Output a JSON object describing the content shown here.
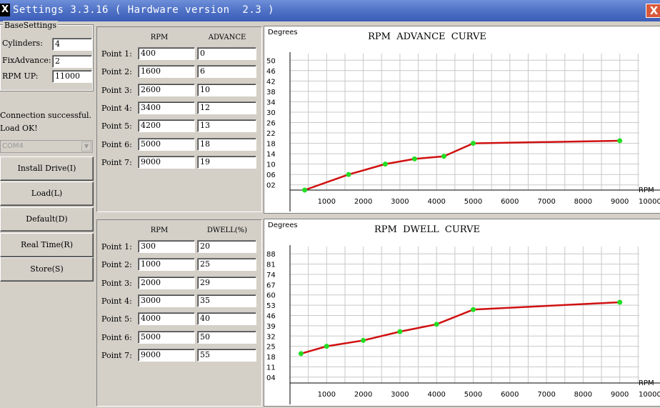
{
  "window": {
    "title": "Settings 3.3.16 ( Hardware version  2.3 )",
    "app_icon": "X",
    "close_label": "X"
  },
  "base_settings": {
    "group_label": "BaseSettings",
    "cylinders_label": "Cylinders:",
    "cylinders_value": "4",
    "fix_advance_label": "FixAdvance:",
    "fix_advance_value": "2",
    "rpm_up_label": "RPM UP:",
    "rpm_up_value": "11000"
  },
  "status": {
    "line1": "Connection successful.",
    "line2": "Load OK!"
  },
  "port": {
    "selected": "COM4"
  },
  "buttons": {
    "install_drive": "Install Drive(I)",
    "load": "Load(L)",
    "default": "Default(D)",
    "real_time": "Real Time(R)",
    "store": "Store(S)"
  },
  "advance_table": {
    "headers": [
      "RPM",
      "ADVANCE"
    ],
    "rows": [
      {
        "label": "Point 1:",
        "rpm": "400",
        "value": "0"
      },
      {
        "label": "Point 2:",
        "rpm": "1600",
        "value": "6"
      },
      {
        "label": "Point 3:",
        "rpm": "2600",
        "value": "10"
      },
      {
        "label": "Point 4:",
        "rpm": "3400",
        "value": "12"
      },
      {
        "label": "Point 5:",
        "rpm": "4200",
        "value": "13"
      },
      {
        "label": "Point 6:",
        "rpm": "5000",
        "value": "18"
      },
      {
        "label": "Point 7:",
        "rpm": "9000",
        "value": "19"
      }
    ]
  },
  "dwell_table": {
    "headers": [
      "RPM",
      "DWELL(%)"
    ],
    "rows": [
      {
        "label": "Point 1:",
        "rpm": "300",
        "value": "20"
      },
      {
        "label": "Point 2:",
        "rpm": "1000",
        "value": "25"
      },
      {
        "label": "Point 3:",
        "rpm": "2000",
        "value": "29"
      },
      {
        "label": "Point 4:",
        "rpm": "3000",
        "value": "35"
      },
      {
        "label": "Point 5:",
        "rpm": "4000",
        "value": "40"
      },
      {
        "label": "Point 6:",
        "rpm": "5000",
        "value": "50"
      },
      {
        "label": "Point 7:",
        "rpm": "9000",
        "value": "55"
      }
    ]
  },
  "colors": {
    "line": "#d01010",
    "point": "#22dd22",
    "grid": "#c8c8c8"
  },
  "chart_data": [
    {
      "type": "line",
      "title": "RPM  ADVANCE  CURVE",
      "ylabel": "Degrees",
      "xlabel": "RPM",
      "x_ticks": [
        "1000",
        "2000",
        "3000",
        "4000",
        "5000",
        "6000",
        "7000",
        "8000",
        "9000",
        "10000"
      ],
      "y_ticks": [
        "02",
        "06",
        "10",
        "14",
        "18",
        "22",
        "26",
        "30",
        "34",
        "38",
        "42",
        "46",
        "50"
      ],
      "xlim": [
        0,
        10000
      ],
      "ylim": [
        0,
        52
      ],
      "x": [
        400,
        1600,
        2600,
        3400,
        4200,
        5000,
        9000
      ],
      "y": [
        0,
        6,
        10,
        12,
        13,
        18,
        19
      ],
      "grid": true
    },
    {
      "type": "line",
      "title": "RPM  DWELL  CURVE",
      "ylabel": "Degrees",
      "xlabel": "RPM",
      "x_ticks": [
        "1000",
        "2000",
        "3000",
        "4000",
        "5000",
        "6000",
        "7000",
        "8000",
        "9000",
        "10000"
      ],
      "y_ticks": [
        "04",
        "11",
        "18",
        "25",
        "32",
        "39",
        "46",
        "53",
        "60",
        "67",
        "74",
        "81",
        "88"
      ],
      "xlim": [
        0,
        10000
      ],
      "ylim": [
        0,
        92
      ],
      "x": [
        300,
        1000,
        2000,
        3000,
        4000,
        5000,
        9000
      ],
      "y": [
        20,
        25,
        29,
        35,
        40,
        50,
        55
      ],
      "grid": true
    }
  ]
}
